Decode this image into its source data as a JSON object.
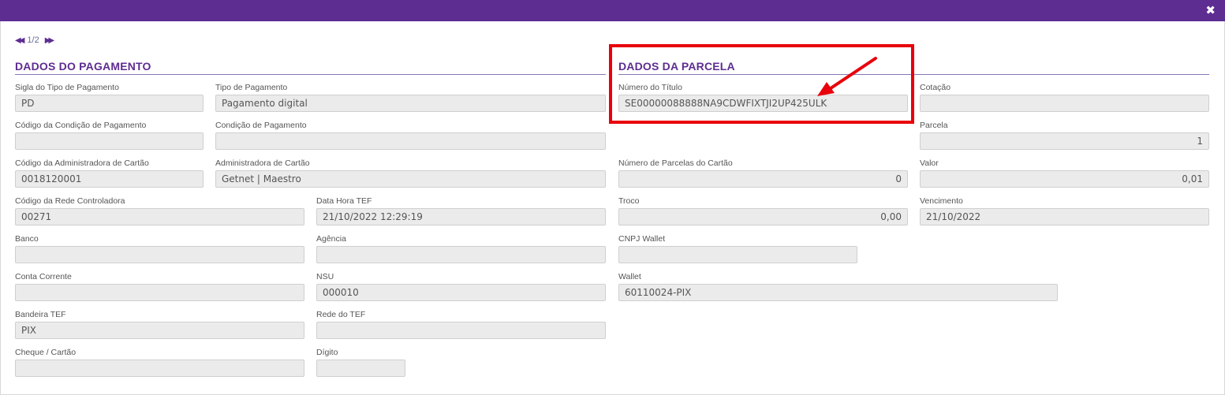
{
  "header": {
    "close_icon": "close-icon",
    "close_glyph": "✖"
  },
  "pager": {
    "prev_glyph": "◀◀",
    "next_glyph": "▶▶",
    "text": "1/2"
  },
  "sections": {
    "payment": {
      "title": "DADOS DO PAGAMENTO"
    },
    "installment": {
      "title": "DADOS DA PARCELA"
    }
  },
  "fields": {
    "sigla_tipo": {
      "label": "Sigla do Tipo de Pagamento",
      "value": "PD"
    },
    "tipo": {
      "label": "Tipo de Pagamento",
      "value": "Pagamento digital"
    },
    "cod_condicao": {
      "label": "Código da Condição de Pagamento",
      "value": ""
    },
    "condicao": {
      "label": "Condição de Pagamento",
      "value": ""
    },
    "cod_admin": {
      "label": "Código da Administradora de Cartão",
      "value": "0018120001"
    },
    "admin": {
      "label": "Administradora de Cartão",
      "value": "Getnet | Maestro"
    },
    "cod_rede": {
      "label": "Código da Rede Controladora",
      "value": "00271"
    },
    "data_hora_tef": {
      "label": "Data Hora TEF",
      "value": "21/10/2022 12:29:19"
    },
    "banco": {
      "label": "Banco",
      "value": ""
    },
    "agencia": {
      "label": "Agência",
      "value": ""
    },
    "conta": {
      "label": "Conta Corrente",
      "value": ""
    },
    "nsu": {
      "label": "NSU",
      "value": "000010"
    },
    "bandeira": {
      "label": "Bandeira TEF",
      "value": "PIX"
    },
    "rede_tef": {
      "label": "Rede do TEF",
      "value": ""
    },
    "cheque": {
      "label": "Cheque / Cartão",
      "value": ""
    },
    "digito": {
      "label": "Dígito",
      "value": ""
    },
    "numero_titulo": {
      "label": "Número do Título",
      "value": "SE00000088888NA9CDWFIXTJI2UP425ULK"
    },
    "cotacao": {
      "label": "Cotação",
      "value": ""
    },
    "parcela": {
      "label": "Parcela",
      "value": "1"
    },
    "num_parcelas": {
      "label": "Número de Parcelas do Cartão",
      "value": "0"
    },
    "valor": {
      "label": "Valor",
      "value": "0,01"
    },
    "troco": {
      "label": "Troco",
      "value": "0,00"
    },
    "vencimento": {
      "label": "Vencimento",
      "value": "21/10/2022"
    },
    "cnpj_wallet": {
      "label": "CNPJ Wallet",
      "value": ""
    },
    "wallet": {
      "label": "Wallet",
      "value": "60110024-PIX"
    }
  },
  "annotation": {
    "highlight_color": "#e8000b"
  },
  "colors": {
    "header_bg": "#5d2d91",
    "accent": "#5d2d91",
    "field_bg": "#ebebeb"
  }
}
